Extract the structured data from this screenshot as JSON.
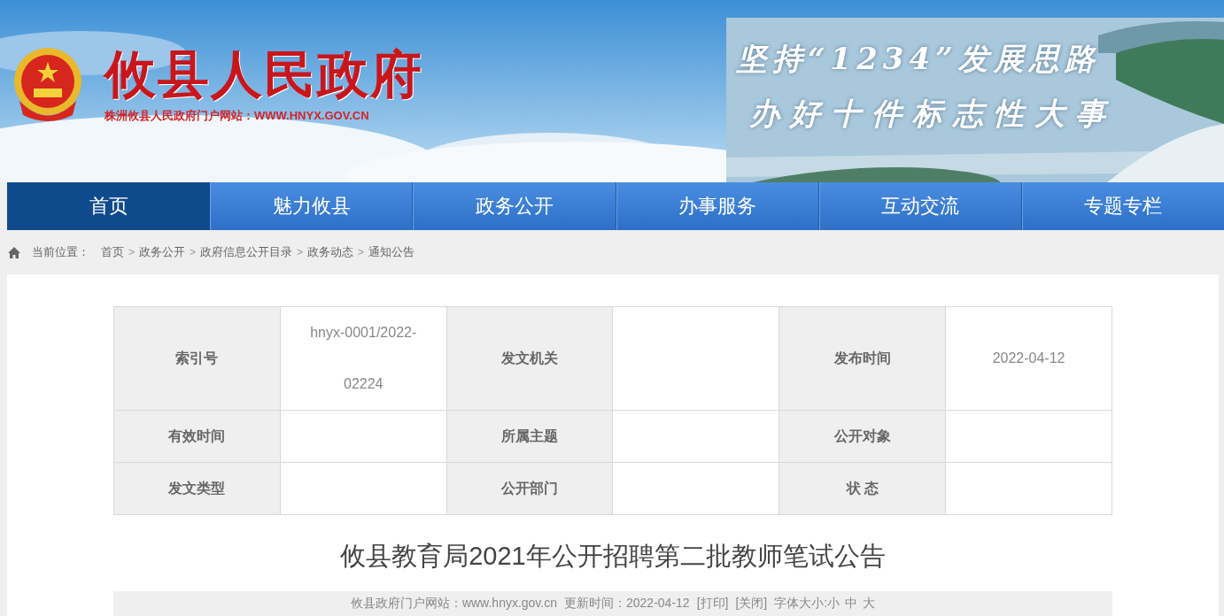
{
  "header": {
    "title": "攸县人民政府",
    "subtitle": "株洲攸县人民政府门户网站：WWW.HNYX.GOV.CN",
    "slogan": [
      "坚持“1234”发展思路",
      "办好十件标志性大事"
    ]
  },
  "nav": [
    {
      "label": "首页",
      "selected": true
    },
    {
      "label": "魅力攸县",
      "selected": false
    },
    {
      "label": "政务公开",
      "selected": false
    },
    {
      "label": "办事服务",
      "selected": false
    },
    {
      "label": "互动交流",
      "selected": false
    },
    {
      "label": "专题专栏",
      "selected": false
    }
  ],
  "breadcrumb": {
    "label": "当前位置：",
    "items": [
      {
        "kind": "link",
        "text": "首页"
      },
      {
        "kind": "separator",
        "text": ">"
      },
      {
        "kind": "link",
        "text": "政务公开"
      },
      {
        "kind": "separator",
        "text": ">"
      },
      {
        "kind": "link",
        "text": "政府信息公开目录"
      },
      {
        "kind": "separator",
        "text": ">"
      },
      {
        "kind": "link",
        "text": "政务动态"
      },
      {
        "kind": "separator",
        "text": ">"
      },
      {
        "kind": "link",
        "text": "通知公告"
      }
    ]
  },
  "meta_table": {
    "rows": [
      [
        {
          "label": "索引号",
          "value": "hnyx-0001/2022-02224"
        },
        {
          "label": "发文机关"
        },
        {
          "label": "发布时间",
          "value": "2022-04-12"
        }
      ],
      [
        {
          "label": "有效时间"
        },
        {
          "label": "所属主题"
        },
        {
          "label": "公开对象"
        }
      ],
      [
        {
          "label": "发文类型"
        },
        {
          "label": "公开部门"
        },
        {
          "label": "状 态"
        }
      ]
    ]
  },
  "article": {
    "title": "攸县教育局2021年公开招聘第二批教师笔试公告"
  },
  "info_bar": {
    "site_label": "攸县政府门户网站：",
    "site_url": "www.hnyx.gov.cn",
    "update_label": "更新时间：",
    "update_time": "2022-04-12",
    "print": "[打印]",
    "close": "[关闭]",
    "font_size_label": "字体大小:",
    "sizes": [
      "小",
      "中",
      "大"
    ]
  }
}
